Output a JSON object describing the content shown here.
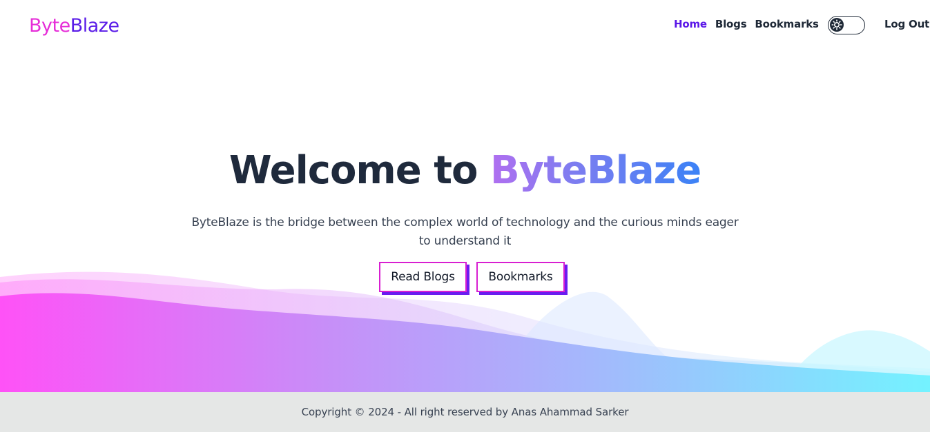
{
  "brand": {
    "name_part1": "Byte",
    "name_part2": "Blaze"
  },
  "nav": {
    "links": [
      {
        "label": "Home",
        "active": true
      },
      {
        "label": "Blogs",
        "active": false
      },
      {
        "label": "Bookmarks",
        "active": false
      }
    ],
    "theme_toggle_icon": "sun-icon",
    "logout_label": "Log Out"
  },
  "hero": {
    "title_prefix": "Welcome to",
    "title_brand": "ByteBlaze",
    "description": "ByteBlaze is the bridge between the complex world of technology and the curious minds eager to understand it",
    "buttons": {
      "read_blogs": "Read Blogs",
      "bookmarks": "Bookmarks"
    }
  },
  "footer": {
    "copyright": "Copyright © 2024 - All right reserved by Anas Ahammad Sarker"
  },
  "colors": {
    "accent": "#5a16e8",
    "logo_pink": "#e62dd8",
    "button_border": "#d81fd1",
    "button_shadow": "#6b1cf0",
    "footer_bg": "#e5e7e6"
  }
}
